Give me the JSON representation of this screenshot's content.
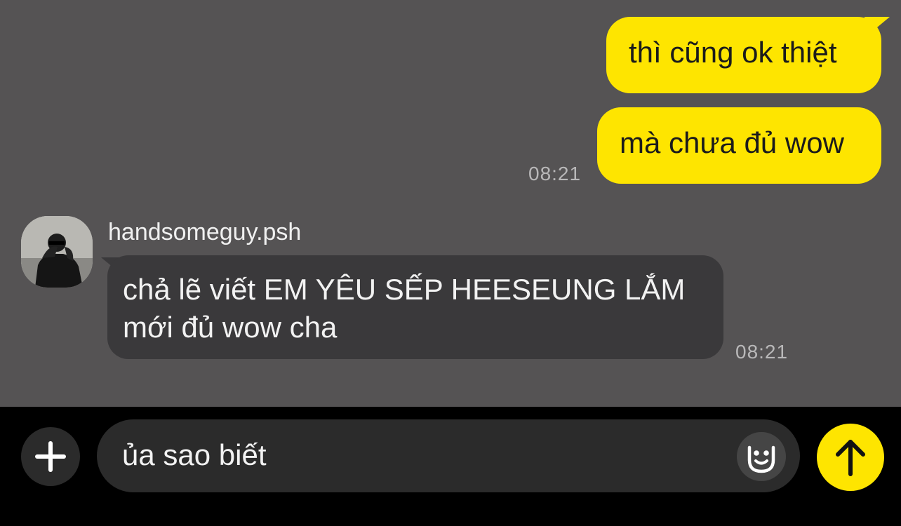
{
  "messages": {
    "outgoing": [
      {
        "text": "thì cũng ok thiệt"
      },
      {
        "text": "mà chưa đủ wow",
        "time": "08:21"
      }
    ],
    "incoming": {
      "sender": "handsomeguy.psh",
      "text": "chả lẽ viết EM YÊU SẾP HEESEUNG LẮM mới đủ wow cha",
      "time": "08:21"
    }
  },
  "composer": {
    "input_value": "ủa sao biết"
  },
  "icons": {
    "plus": "plus-icon",
    "emoji": "smiley-icon",
    "send": "arrow-up-icon"
  },
  "colors": {
    "chat_background": "#555354",
    "outgoing_bubble": "#fee500",
    "incoming_bubble": "#3a393b",
    "bottom_bar": "#000000",
    "send_button": "#fee500"
  }
}
